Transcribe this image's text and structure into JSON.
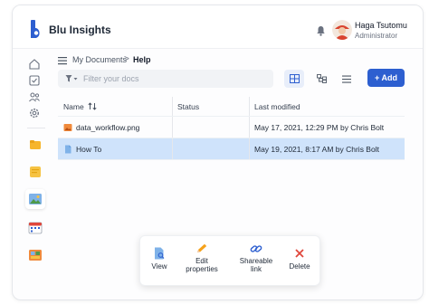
{
  "app": {
    "brand": "Blu Insights"
  },
  "user": {
    "name": "Haga Tsutomu",
    "role": "Administrator"
  },
  "breadcrumb": {
    "parent": "My Documents",
    "separator": ">",
    "current": "Help"
  },
  "filter": {
    "placeholder": "Filter your docs"
  },
  "toolbar": {
    "add_label": "+ Add"
  },
  "table": {
    "headers": {
      "name": "Name",
      "status": "Status",
      "modified": "Last modified"
    },
    "rows": [
      {
        "name": "data_workflow.png",
        "status": "",
        "modified": "May 17, 2021, 12:29 PM by Chris Bolt",
        "icon": "image-file-icon"
      },
      {
        "name": "How To",
        "status": "",
        "modified": "May 19, 2021, 8:17 AM by Chris Bolt",
        "icon": "document-icon",
        "selected": true
      }
    ]
  },
  "actions": {
    "view": "View",
    "edit_line1": "Edit",
    "edit_line2": "properties",
    "share_line1": "Shareable",
    "share_line2": "link",
    "delete": "Delete"
  },
  "colors": {
    "accent": "#2d5fd0",
    "selected_row": "#cfe3fb",
    "delete": "#e0473c"
  }
}
